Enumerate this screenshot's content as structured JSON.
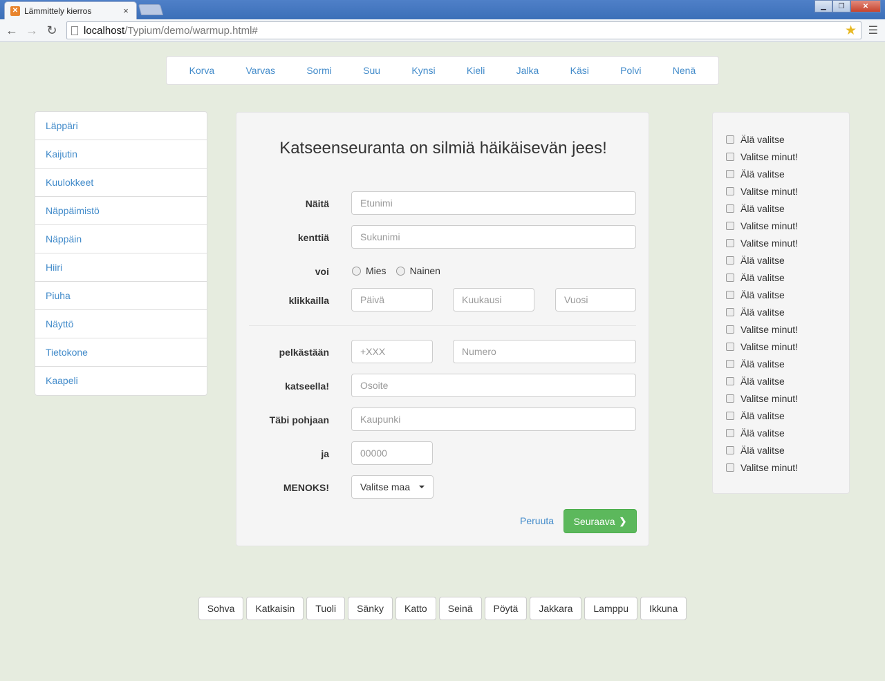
{
  "browser": {
    "tab_title": "Lämmittely kierros",
    "tab_close": "×",
    "url_host": "localhost",
    "url_path": "/Typium/demo/warmup.html#"
  },
  "topnav": [
    "Korva",
    "Varvas",
    "Sormi",
    "Suu",
    "Kynsi",
    "Kieli",
    "Jalka",
    "Käsi",
    "Polvi",
    "Nenä"
  ],
  "sidebar": [
    "Läppäri",
    "Kaijutin",
    "Kuulokkeet",
    "Näppäimistö",
    "Näppäin",
    "Hiiri",
    "Piuha",
    "Näyttö",
    "Tietokone",
    "Kaapeli"
  ],
  "form": {
    "heading": "Katseenseuranta on silmiä häikäisevän jees!",
    "labels": {
      "first": "Näitä",
      "last": "kenttiä",
      "gender": "voi",
      "date": "klikkailla",
      "phone": "pelkästään",
      "address": "katseella!",
      "city": "Täbi pohjaan",
      "zip": "ja",
      "country": "MENOKS!"
    },
    "placeholders": {
      "first": "Etunimi",
      "last": "Sukunimi",
      "day": "Päivä",
      "month": "Kuukausi",
      "year": "Vuosi",
      "prefix": "+XXX",
      "number": "Numero",
      "address": "Osoite",
      "city": "Kaupunki",
      "zip": "00000"
    },
    "gender_options": [
      "Mies",
      "Nainen"
    ],
    "country_select": "Valitse maa",
    "cancel": "Peruuta",
    "next": "Seuraava"
  },
  "checkboxes": [
    "Älä valitse",
    "Valitse minut!",
    "Älä valitse",
    "Valitse minut!",
    "Älä valitse",
    "Valitse minut!",
    "Valitse minut!",
    "Älä valitse",
    "Älä valitse",
    "Älä valitse",
    "Älä valitse",
    "Valitse minut!",
    "Valitse minut!",
    "Älä valitse",
    "Älä valitse",
    "Valitse minut!",
    "Älä valitse",
    "Älä valitse",
    "Älä valitse",
    "Valitse minut!"
  ],
  "bottom_buttons": [
    "Sohva",
    "Katkaisin",
    "Tuoli",
    "Sänky",
    "Katto",
    "Seinä",
    "Pöytä",
    "Jakkara",
    "Lamppu",
    "Ikkuna"
  ],
  "colors": {
    "accent": "#428bca",
    "success": "#5cb85c",
    "background": "#e6ecdf"
  }
}
